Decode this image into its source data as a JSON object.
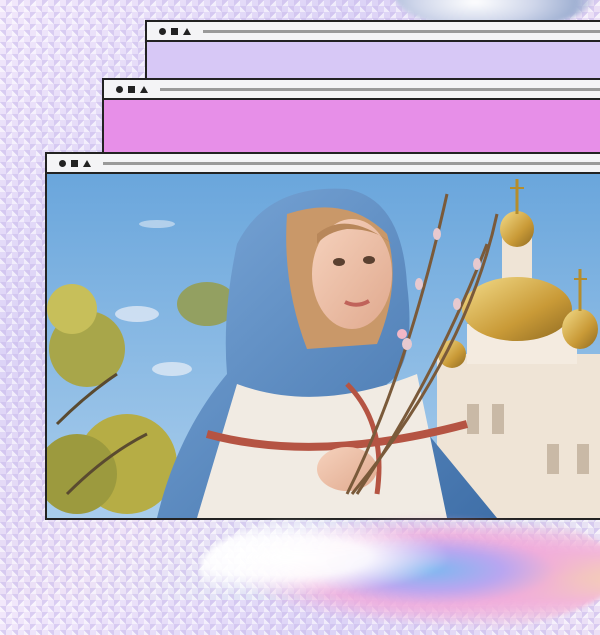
{
  "background": {
    "palette": [
      "#e9ddf3",
      "#dcd3f6",
      "#d9e4f5"
    ]
  },
  "windows": [
    {
      "id": "back",
      "fill": "#d7c8f6",
      "controls": [
        "circle-icon",
        "square-icon",
        "triangle-icon"
      ]
    },
    {
      "id": "middle",
      "fill": "#e78fe8",
      "controls": [
        "circle-icon",
        "square-icon",
        "triangle-icon"
      ]
    },
    {
      "id": "front",
      "content": "illustration",
      "controls": [
        "circle-icon",
        "square-icon",
        "triangle-icon"
      ]
    }
  ],
  "colors": {
    "border": "#222222",
    "titlebar": "#f4f4f6",
    "sky": "#7fb2e2",
    "cloak": "#5b8fc7",
    "gold": "#d9b24a"
  }
}
